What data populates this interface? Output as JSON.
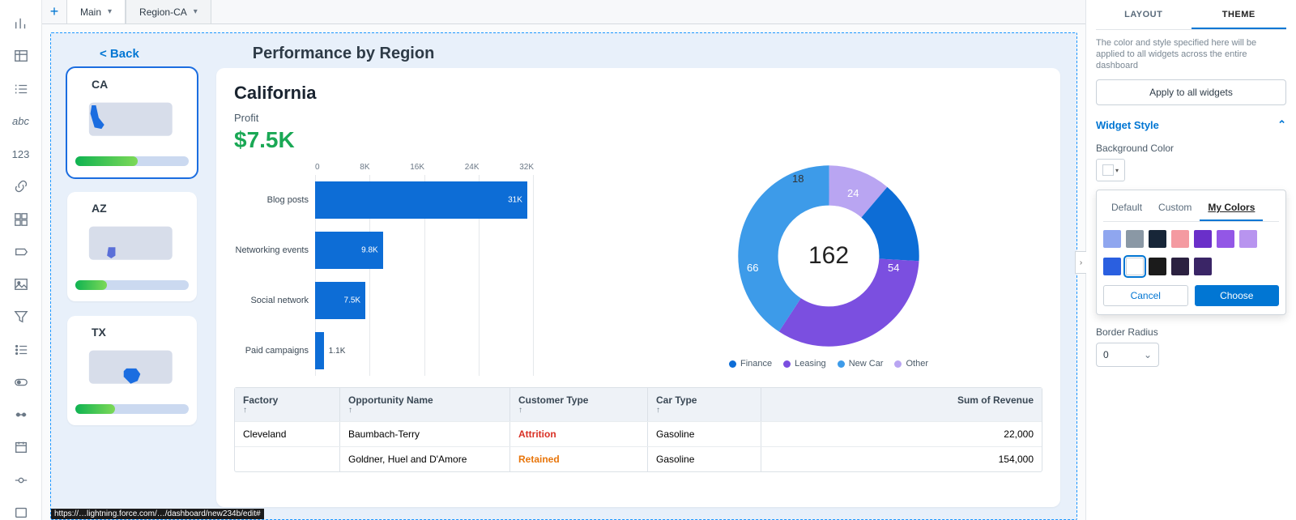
{
  "tabs": {
    "tab1": "Main",
    "tab2": "Region-CA"
  },
  "back_label": "< Back",
  "page_title": "Performance by Region",
  "regions": {
    "ca": {
      "name": "CA",
      "fill_pct": 55,
      "highlight": "#1b6de0"
    },
    "az": {
      "name": "AZ",
      "fill_pct": 28,
      "highlight": "#5a6fd8"
    },
    "tx": {
      "name": "TX",
      "fill_pct": 35,
      "highlight": "#1b6de0"
    }
  },
  "widget": {
    "title": "California",
    "metric_label": "Profit",
    "metric_value": "$7.5K"
  },
  "chart_data": [
    {
      "type": "bar",
      "orientation": "horizontal",
      "categories": [
        "Blog posts",
        "Networking events",
        "Social network",
        "Paid campaigns"
      ],
      "values": [
        31000,
        9800,
        7500,
        1100
      ],
      "value_labels": [
        "31K",
        "9.8K",
        "7.5K",
        "1.1K"
      ],
      "xlim": [
        0,
        32000
      ],
      "xticks": [
        "0",
        "8K",
        "16K",
        "24K",
        "32K"
      ]
    },
    {
      "type": "donut",
      "center_value": "162",
      "series": [
        {
          "name": "Finance",
          "value": 24,
          "color": "#0d6dd6"
        },
        {
          "name": "Leasing",
          "value": 54,
          "color": "#7b4fe0"
        },
        {
          "name": "New Car",
          "value": 66,
          "color": "#3d9be9"
        },
        {
          "name": "Other",
          "value": 18,
          "color": "#b9a5f2"
        }
      ]
    }
  ],
  "table": {
    "headers": {
      "factory": "Factory",
      "opp": "Opportunity Name",
      "cust": "Customer Type",
      "car": "Car Type",
      "rev": "Sum of Revenue"
    },
    "sort_arrow": "↑",
    "rows": [
      {
        "factory": "Cleveland",
        "opp": "Baumbach-Terry",
        "cust": "Attrition",
        "cust_class": "ct-attr",
        "car": "Gasoline",
        "rev": "22,000"
      },
      {
        "factory": "",
        "opp": "Goldner, Huel and D'Amore",
        "cust": "Retained",
        "cust_class": "ct-ret",
        "car": "Gasoline",
        "rev": "154,000"
      }
    ]
  },
  "theme_panel": {
    "tab_layout": "LAYOUT",
    "tab_theme": "THEME",
    "desc": "The color and style specified here will be applied to all widgets across the entire dashboard",
    "apply": "Apply to all widgets",
    "section": "Widget Style",
    "bg_label": "Background Color",
    "color_tabs": {
      "default": "Default",
      "custom": "Custom",
      "mycolors": "My Colors"
    },
    "palette_row1": [
      "#8fa6ef",
      "#8a98a5",
      "#172638",
      "#f49aa1",
      "#6a2fc9",
      "#9357e6",
      "#b894ef"
    ],
    "palette_row2": [
      "#2a5fe0",
      "#ffffff",
      "#1b1b1b",
      "#2b2140",
      "#3a2566"
    ],
    "cancel": "Cancel",
    "choose": "Choose",
    "radius_label": "Border Radius",
    "radius_value": "0"
  },
  "url_hint": "https://…lightning.force.com/…/dashboard/new234b/edit#"
}
